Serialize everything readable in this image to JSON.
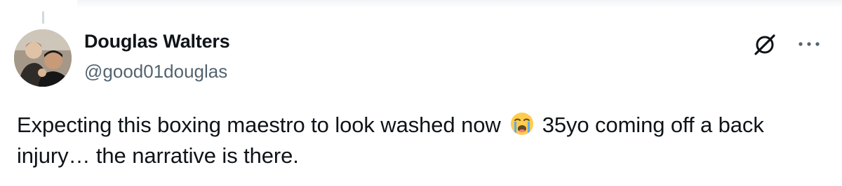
{
  "tweet": {
    "author_name": "Douglas Walters",
    "author_handle": "@good01douglas",
    "text_before_emoji": "Expecting this boxing maestro to look washed now",
    "emoji": "loudly-crying-face",
    "text_after_emoji": " 35yo coming off a back injury… the narrative is there."
  },
  "icons": {
    "grok": "grok-icon",
    "more": "more-options-icon"
  },
  "colors": {
    "text": "#0f1419",
    "secondary_text": "#536471",
    "thread_line": "#cfd9de",
    "background": "#ffffff"
  }
}
